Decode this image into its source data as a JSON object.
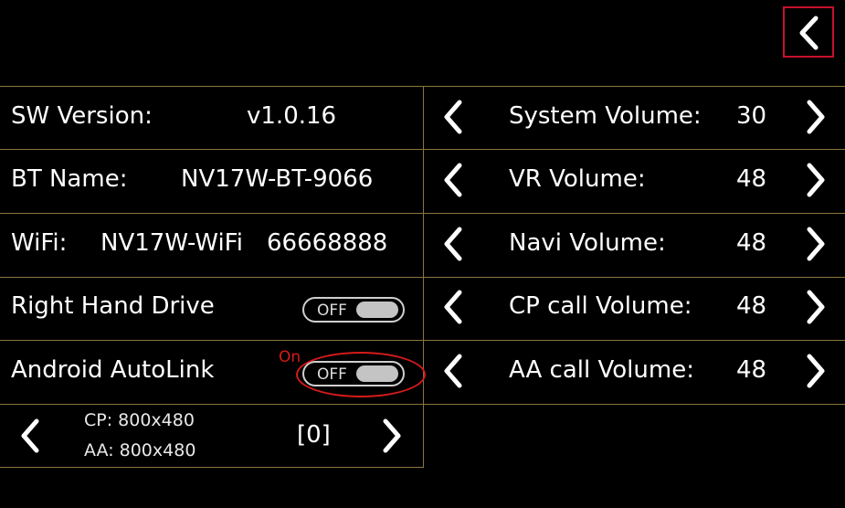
{
  "header": {
    "back_icon": "chevron-left-icon",
    "accent": "#c8102e"
  },
  "info": {
    "sw_version_label": "SW Version:",
    "sw_version_value": "v1.0.16",
    "bt_name_label": "BT Name:",
    "bt_name_value": "NV17W-BT-9066",
    "wifi_label": "WiFi:",
    "wifi_name": "NV17W-WiFi",
    "wifi_password": "66668888",
    "rhd_label": "Right Hand Drive",
    "rhd_toggle": "OFF",
    "autolink_label": "Android AutoLink",
    "autolink_toggle": "OFF",
    "autolink_annotation": "On",
    "cp_resolution": "CP: 800x480",
    "aa_resolution": "AA: 800x480",
    "resolution_index": "[0]"
  },
  "volumes": [
    {
      "label": "System Volume:",
      "value": "30"
    },
    {
      "label": "VR Volume:",
      "value": "48"
    },
    {
      "label": "Navi Volume:",
      "value": "48"
    },
    {
      "label": "CP call Volume:",
      "value": "48"
    },
    {
      "label": "AA call Volume:",
      "value": "48"
    }
  ],
  "colors": {
    "divider": "#8a7540",
    "annotation": "#d51a1a",
    "background": "#000000"
  }
}
